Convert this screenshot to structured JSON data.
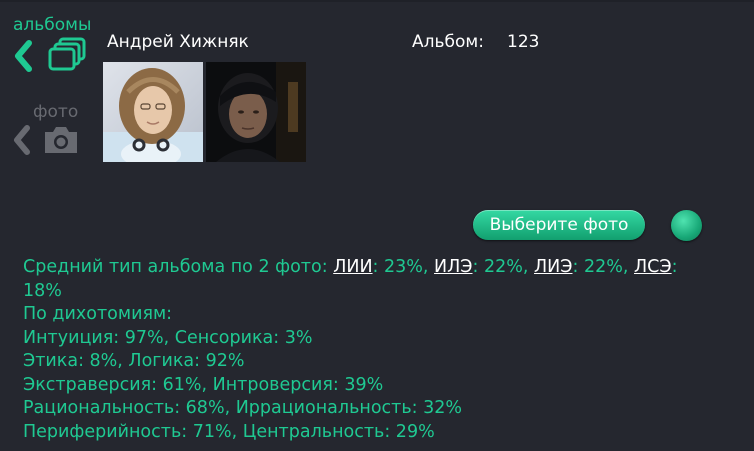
{
  "nav": {
    "albums_label": "альбомы",
    "photo_label": "фото"
  },
  "header": {
    "user_name": "Андрей Хижняк",
    "album_label": "Альбом:",
    "album_number": "123"
  },
  "thumbnails": [
    {
      "name": "photo-thumbnail-1"
    },
    {
      "name": "photo-thumbnail-2"
    }
  ],
  "actions": {
    "choose_photo_label": "Выберите фото"
  },
  "results": {
    "average_prefix": "Средний тип альбома по 2 фото:",
    "types": [
      {
        "code": "ЛИИ",
        "value": ": 23%,"
      },
      {
        "code": "ИЛЭ",
        "value": ": 22%,"
      },
      {
        "code": "ЛИЭ",
        "value": ": 22%,"
      },
      {
        "code": "ЛСЭ",
        "value": ":"
      }
    ],
    "last_value": "18%",
    "dichotomies_heading": "По дихотомиям:",
    "dichotomies": [
      "Интуиция: 97%, Сенсорика: 3%",
      "Этика: 8%, Логика: 92%",
      "Экстраверсия: 61%, Интроверсия: 39%",
      "Рациональность: 68%, Иррациональность: 32%",
      "Периферийность: 71%, Центральность: 29%"
    ]
  },
  "colors": {
    "background": "#25272f",
    "accent": "#1fc992",
    "text_white": "#ffffff",
    "disabled": "#686a71"
  }
}
